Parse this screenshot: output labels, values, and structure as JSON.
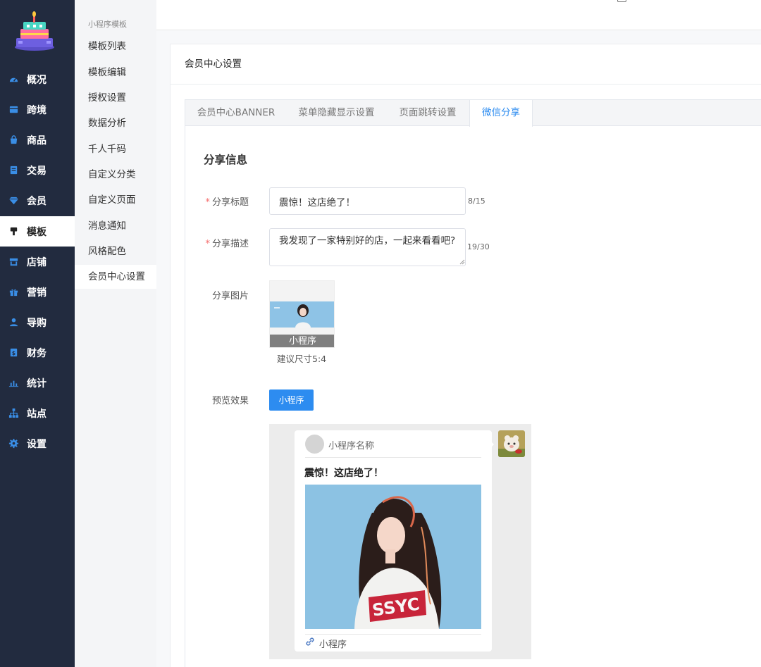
{
  "nav": {
    "items": [
      {
        "label": "概况",
        "icon": "dashboard-icon"
      },
      {
        "label": "跨境",
        "icon": "card-icon"
      },
      {
        "label": "商品",
        "icon": "bag-icon"
      },
      {
        "label": "交易",
        "icon": "document-icon"
      },
      {
        "label": "会员",
        "icon": "diamond-icon"
      },
      {
        "label": "模板",
        "icon": "brush-icon"
      },
      {
        "label": "店铺",
        "icon": "store-icon"
      },
      {
        "label": "营销",
        "icon": "gift-icon"
      },
      {
        "label": "导购",
        "icon": "person-icon"
      },
      {
        "label": "财务",
        "icon": "ledger-icon"
      },
      {
        "label": "统计",
        "icon": "bar-chart-icon"
      },
      {
        "label": "站点",
        "icon": "sitemap-icon"
      },
      {
        "label": "设置",
        "icon": "gear-icon"
      }
    ],
    "active": "模板"
  },
  "subnav": {
    "title": "小程序模板",
    "items": [
      "模板列表",
      "模板编辑",
      "授权设置",
      "数据分析",
      "千人千码",
      "自定义分类",
      "自定义页面",
      "消息通知",
      "风格配色",
      "会员中心设置"
    ],
    "active": "会员中心设置"
  },
  "page": {
    "card_title": "会员中心设置",
    "tabs": [
      "会员中心BANNER",
      "菜单隐藏显示设置",
      "页面跳转设置",
      "微信分享"
    ],
    "active_tab": "微信分享",
    "section_title": "分享信息",
    "form": {
      "title_label": "分享标题",
      "title_value": "震惊！这店绝了！",
      "title_counter": "8/15",
      "desc_label": "分享描述",
      "desc_value": "我发现了一家特别好的店，一起来看看吧?",
      "desc_counter": "19/30",
      "image_label": "分享图片",
      "image_caption": "小程序",
      "image_hint": "建议尺寸5:4",
      "preview_label": "预览效果",
      "preview_button": "小程序"
    },
    "preview": {
      "mini_name": "小程序名称",
      "card_title": "震惊！这店绝了！",
      "footer_label": "小程序"
    }
  },
  "colors": {
    "nav_bg": "#222b3f",
    "accent": "#2d8cf0",
    "required": "#f56c6c"
  }
}
